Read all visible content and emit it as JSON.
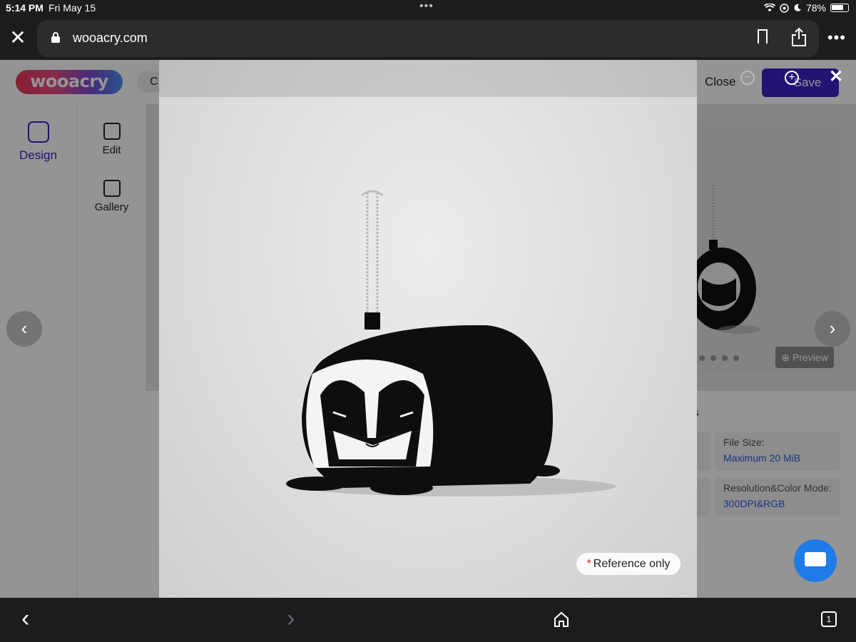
{
  "status_bar": {
    "time": "5:14 PM",
    "date": "Fri May 15",
    "battery": "78%",
    "multitask_dots": "•••"
  },
  "browser": {
    "url": "wooacry.com",
    "close_icon": "close-icon",
    "lock_icon": "lock-icon",
    "more_label": "•••",
    "tab_count": "1"
  },
  "site": {
    "logo_text": "wooacry",
    "header_chip": "C",
    "close_label": "Close",
    "save_label": "Save",
    "nav": {
      "design": "Design",
      "edit": "Edit",
      "gallery": "Gallery"
    },
    "info_title_suffix": "s",
    "info": [
      {
        "key": "File Size:",
        "value": "Maximum 20 MiB"
      },
      {
        "key": "Resolution&Color Mode:",
        "value": "300DPI&RGB"
      }
    ],
    "preview_label": "Preview"
  },
  "lightbox": {
    "reference_star": "*",
    "reference_text": "Reference only",
    "prev_glyph": "‹",
    "next_glyph": "›",
    "close_glyph": "✕",
    "zoom_in_glyph": "+",
    "zoom_out_glyph": "−"
  },
  "toolbar": {
    "back_glyph": "‹",
    "forward_glyph": "›"
  },
  "colors": {
    "brand": "#3b22c8",
    "chat": "#1e7be8",
    "link": "#2b63d9",
    "browser_chrome": "#1c1c1e"
  }
}
